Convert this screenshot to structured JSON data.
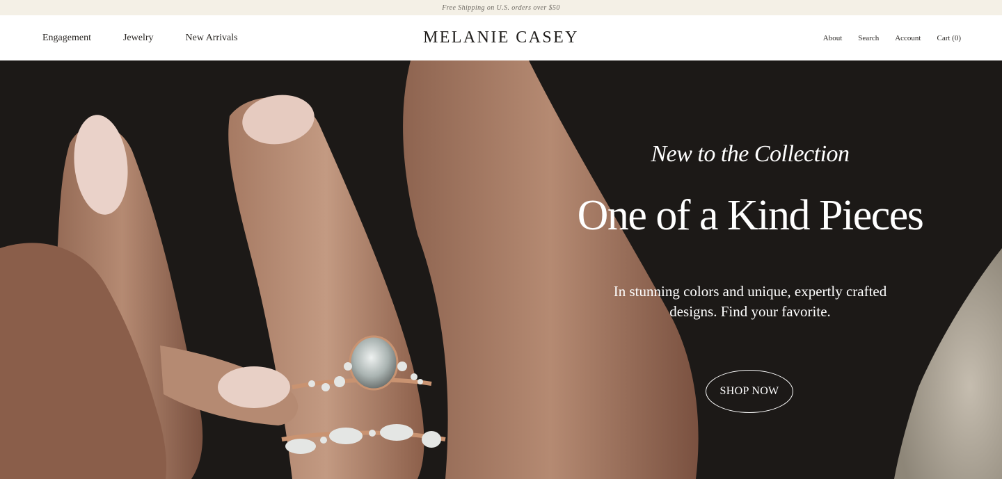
{
  "announcement": "Free Shipping on U.S. orders over $50",
  "nav_left": [
    "Engagement",
    "Jewelry",
    "New Arrivals"
  ],
  "logo": "MELANIE CASEY",
  "nav_right": [
    "About",
    "Search",
    "Account",
    "Cart (0)"
  ],
  "hero": {
    "kicker": "New to the Collection",
    "headline": "One of a Kind Pieces",
    "subtext": "In stunning colors and unique, expertly crafted designs. Find your favorite.",
    "cta": "SHOP NOW"
  },
  "colors": {
    "announcement_bg": "#f4f0e6",
    "header_bg": "#ffffff",
    "hero_bg": "#1c1917",
    "text_light": "#ffffff",
    "text_dark": "#2a2724"
  }
}
